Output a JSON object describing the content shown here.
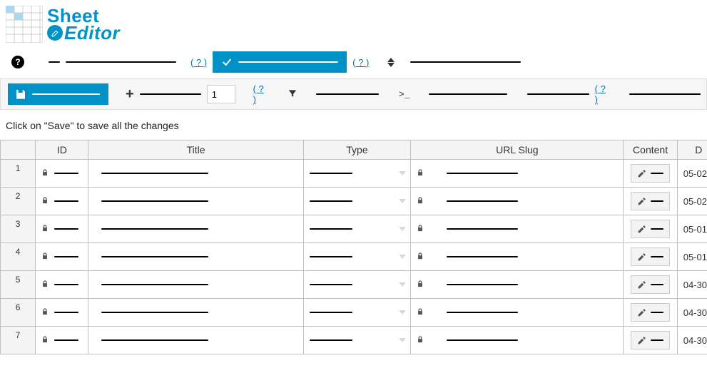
{
  "logo": {
    "line1": "Sheet",
    "line2": "Editor"
  },
  "toolbar1": {
    "hint1": "?",
    "hint2": "?"
  },
  "toolbar2": {
    "new_rows_value": "1",
    "hint1": "?",
    "hint2": "?"
  },
  "hint": "Click on \"Save\" to save all the changes",
  "columns": {
    "id": "ID",
    "title": "Title",
    "type": "Type",
    "slug": "URL Slug",
    "content": "Content",
    "date": "D"
  },
  "rows": [
    {
      "num": "1",
      "date": "05-02"
    },
    {
      "num": "2",
      "date": "05-02"
    },
    {
      "num": "3",
      "date": "05-01"
    },
    {
      "num": "4",
      "date": "05-01"
    },
    {
      "num": "5",
      "date": "04-30"
    },
    {
      "num": "6",
      "date": "04-30"
    },
    {
      "num": "7",
      "date": "04-30"
    }
  ]
}
